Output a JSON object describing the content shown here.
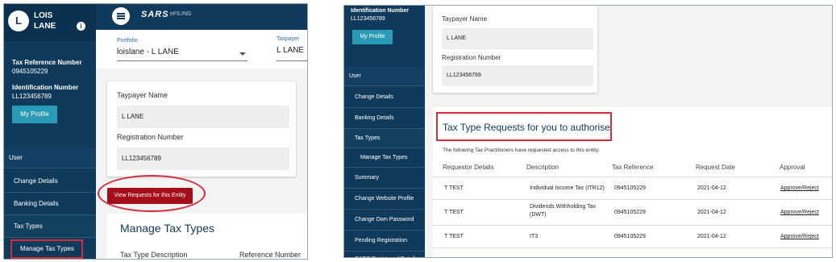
{
  "left": {
    "avatar_initial": "L",
    "user_name_line1": "LOIS",
    "user_name_line2": "LANE",
    "info_icon_glyph": "i",
    "tax_ref_label": "Tax Reference Number",
    "tax_ref_value": "0945105229",
    "id_label": "Identification Number",
    "id_value": "LL123456789",
    "profile_button": "My Profile",
    "nav": [
      "User",
      "Change Details",
      "Banking Details",
      "Tax Types",
      "Manage Tax Types"
    ],
    "topbar": {
      "logo": "SARS",
      "logo_sub": "eFILING"
    },
    "portfolio_label": "Portfolio",
    "portfolio_value": "loislane - L LANE",
    "taxpayer_label": "Taxpayer",
    "taxpayer_value": "L LANE",
    "taxpayer_name_label": "Taypayer Name",
    "taxpayer_name_value": "L LANE",
    "registration_label": "Registration Number",
    "registration_value": "LL123456789",
    "view_requests_button": "View Requests for this Entity",
    "manage_title": "Manage Tax Types",
    "col_tax_type_desc": "Tax Type Description",
    "col_reference_number": "Reference Number"
  },
  "right": {
    "id_label": "Identification Number",
    "id_value": "LL123456789",
    "profile_button": "My Profile",
    "nav": [
      "User",
      "Change Details",
      "Banking Details",
      "Tax Types",
      "Manage Tax Types",
      "Summary",
      "Change Website Profile",
      "Change Own Password",
      "Pending Registration",
      "SARS Registered Details"
    ],
    "taxpayer_name_label": "Taypayer Name",
    "taxpayer_name_value": "L LANE",
    "registration_label": "Registration Number",
    "registration_value": "LL123456789",
    "requests_title": "Tax Type Requests for you to authorise",
    "requests_subtitle": "The following Tax Practitioners have requested access to this entity:",
    "headers": [
      "Requestor Details",
      "Description",
      "Tax Reference",
      "Request Date",
      "Approval"
    ],
    "rows": [
      {
        "requestor": "T TEST",
        "description": "Individual Income Tax (ITR12)",
        "description2": "",
        "tax_ref": "0945105229",
        "date": "2021-04-12",
        "action": "Approve/Reject"
      },
      {
        "requestor": "T TEST",
        "description": "Dividends Withholding Tax",
        "description2": "(DWT)",
        "tax_ref": "0945105229",
        "date": "2021-04-12",
        "action": "Approve/Reject"
      },
      {
        "requestor": "T TEST",
        "description": "IT3",
        "description2": "",
        "tax_ref": "0945105229",
        "date": "2021-04-12",
        "action": "Approve/Reject"
      }
    ]
  },
  "colors": {
    "navy": "#0f3a5b",
    "teal_button": "#2a9bb5",
    "red_button": "#a50d1a",
    "highlight": "#d62b3a"
  }
}
